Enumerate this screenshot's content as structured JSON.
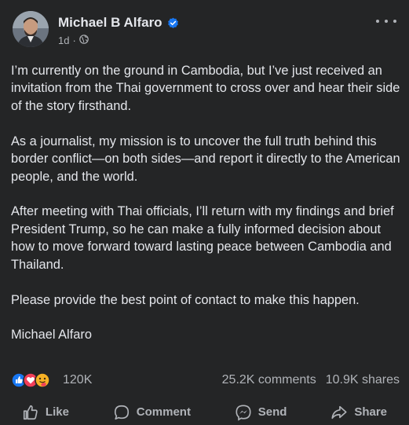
{
  "post": {
    "author": "Michael B Alfaro",
    "time": "1d",
    "separator": "·",
    "icons": {
      "verified": "verified-badge-icon",
      "audience": "globe-icon",
      "more": "more-options-icon"
    },
    "paragraphs": [
      "I’m currently on the ground in Cambodia, but I’ve just received an invitation from the Thai government to cross over and hear their side of the story firsthand.",
      "As a journalist, my mission is to uncover the full truth behind this border conflict—on both sides—and report it directly to the American people, and the world.",
      "After meeting with Thai officials, I’ll return with my findings and brief President Trump, so he can make a fully informed decision about how to move forward toward lasting peace between Cambodia and Thailand.",
      "Please provide the best point of contact to make this happen.",
      "Michael Alfaro"
    ],
    "reactions": {
      "count": "120K",
      "types": [
        "like",
        "love",
        "care"
      ]
    },
    "comments": "25.2K comments",
    "shares": "10.9K shares"
  },
  "actions": {
    "like": "Like",
    "comment": "Comment",
    "send": "Send",
    "share": "Share"
  },
  "colors": {
    "background": "#242526",
    "text": "#e4e6eb",
    "secondary_text": "#b0b3b8",
    "like_blue": "#1877f2",
    "love_red": "#f33e58",
    "care_yellow": "#f7b125"
  }
}
